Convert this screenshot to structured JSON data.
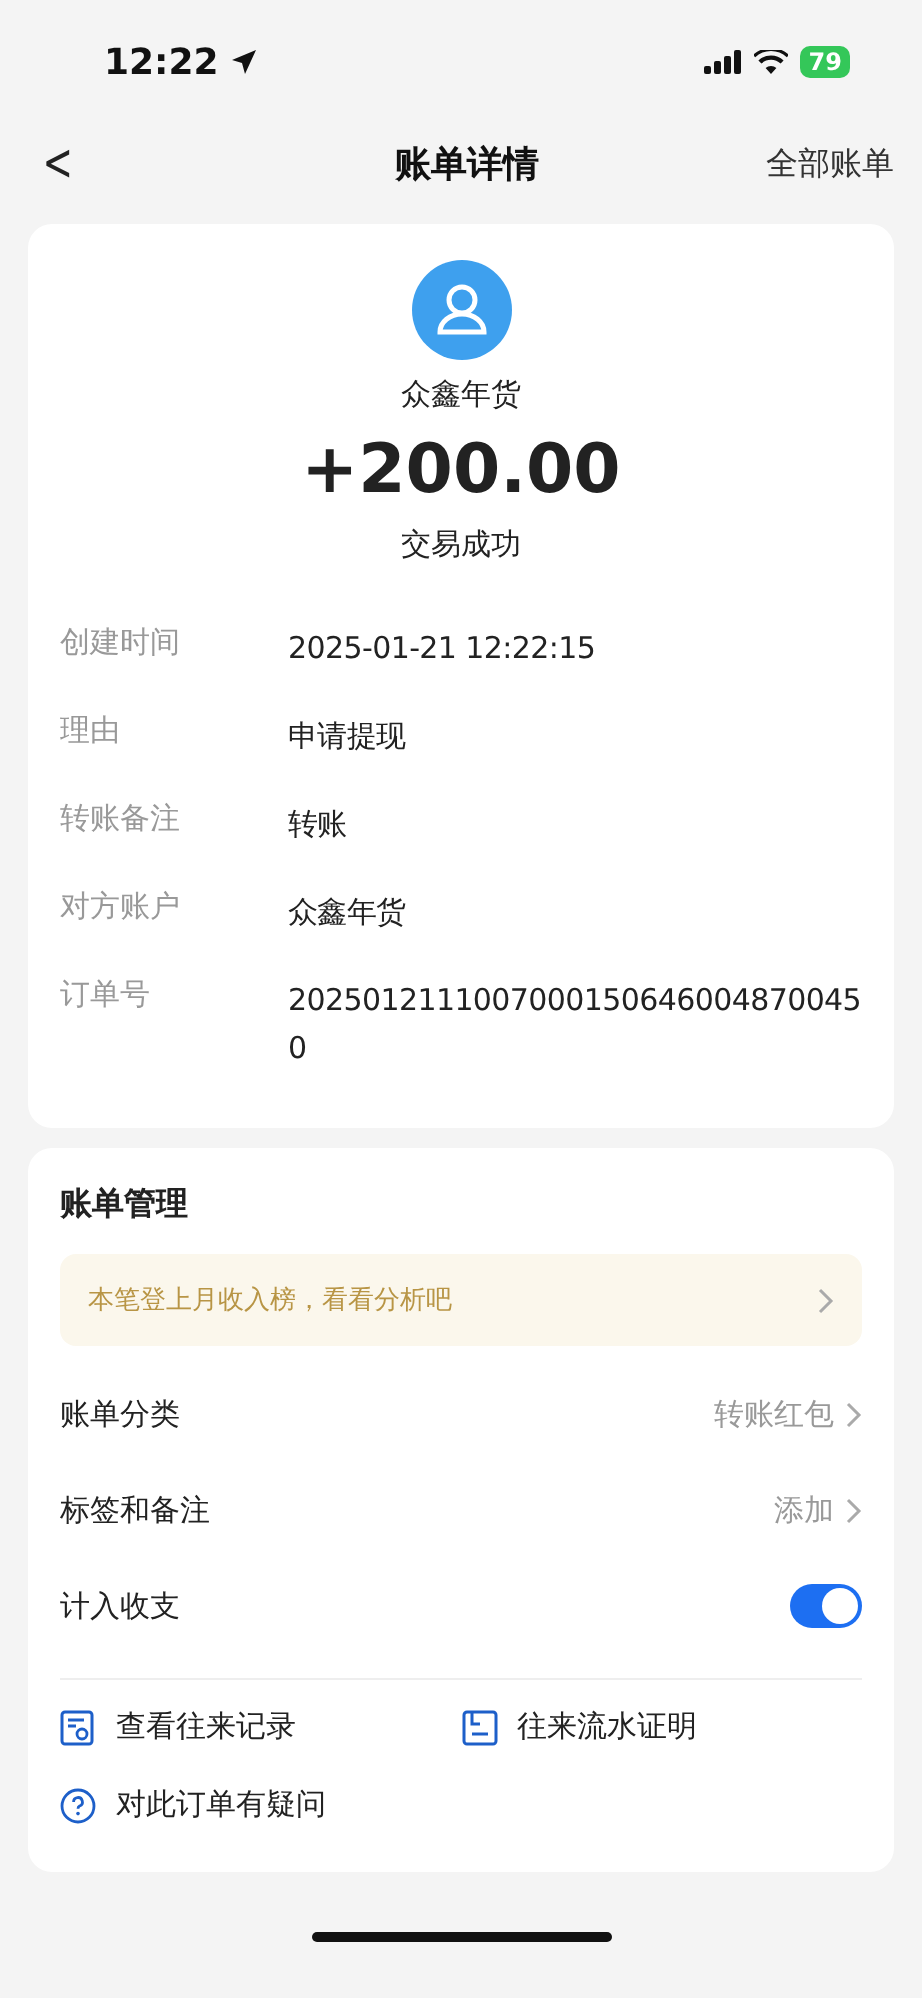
{
  "status_bar": {
    "time": "12:22",
    "battery": "79"
  },
  "nav": {
    "back": "<",
    "title": "账单详情",
    "action": "全部账单"
  },
  "summary": {
    "name": "众鑫年货",
    "amount": "+200.00",
    "status": "交易成功"
  },
  "details": [
    {
      "label": "创建时间",
      "value": "2025-01-21 12:22:15"
    },
    {
      "label": "理由",
      "value": "申请提现"
    },
    {
      "label": "转账备注",
      "value": "转账"
    },
    {
      "label": "对方账户",
      "value": "众鑫年货"
    },
    {
      "label": "订单号",
      "value": "20250121110070001506460048700450"
    }
  ],
  "management": {
    "title": "账单管理",
    "banner": "本笔登上月收入榜，看看分析吧",
    "rows": [
      {
        "kind": "link",
        "label": "账单分类",
        "value": "转账红包"
      },
      {
        "kind": "link",
        "label": "标签和备注",
        "value": "添加"
      },
      {
        "kind": "toggle",
        "label": "计入收支",
        "on": true
      }
    ],
    "actions": [
      {
        "kind": "records",
        "label": "查看往来记录"
      },
      {
        "kind": "proof",
        "label": "往来流水证明"
      },
      {
        "kind": "question",
        "label": "对此订单有疑问"
      }
    ]
  }
}
